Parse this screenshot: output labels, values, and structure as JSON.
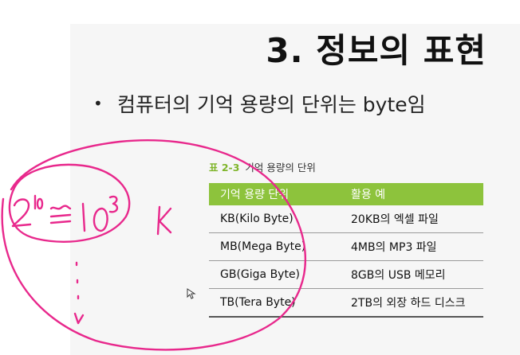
{
  "slide": {
    "title": "3. 정보의 표현",
    "bullet": "컴퓨터의 기억 용량의 단위는 byte임",
    "bullet_symbol": "•"
  },
  "table": {
    "caption_number": "표 2-3",
    "caption_text": "기억 용량의 단위",
    "headers": [
      "기억 용량 단위",
      "활용 예"
    ],
    "rows": [
      [
        "KB(Kilo Byte)",
        "20KB의 엑셀 파일"
      ],
      [
        "MB(Mega Byte)",
        "4MB의 MP3 파일"
      ],
      [
        "GB(Giga Byte)",
        "8GB의 USB 메모리"
      ],
      [
        "TB(Tera Byte)",
        "2TB의 외장 하드 디스크"
      ]
    ],
    "header_color": "#8dc33c"
  },
  "annotation": {
    "ink_color": "#e8288c",
    "handwriting": "2¹⁰ ≅ 10³  K"
  }
}
